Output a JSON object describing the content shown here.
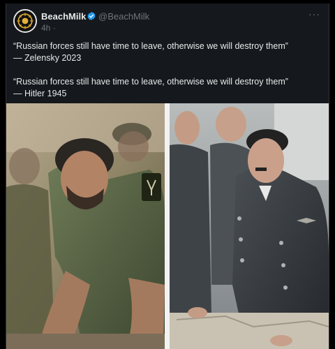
{
  "post": {
    "author_name": "BeachMilk",
    "handle": "@BeachMilk",
    "timestamp": "4h",
    "separator": "·",
    "more_label": "···",
    "verified": true,
    "text": {
      "quote1": "“Russian forces still have time to leave, otherwise we will destroy them”",
      "attrib1": "— Zelensky 2023",
      "quote2": "“Russian forces still have time to leave, otherwise we will destroy them”",
      "attrib2": "— Hitler 1945"
    }
  },
  "colors": {
    "background": "#000000",
    "card": "#15181c",
    "secondary_text": "#71767b",
    "verified_blue": "#1d9bf0"
  },
  "icons": {
    "avatar": "avatar-logo-icon",
    "verified": "verified-badge-icon",
    "more": "more-options-icon"
  }
}
